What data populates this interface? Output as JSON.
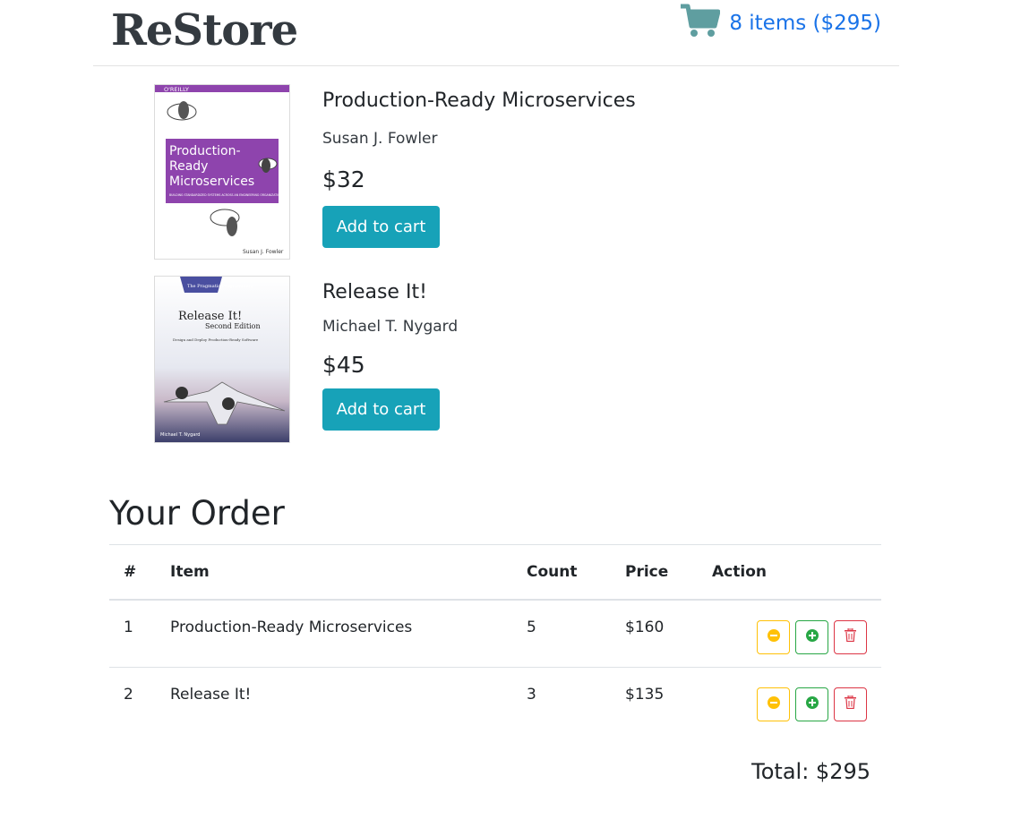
{
  "header": {
    "brand": "ReStore",
    "cart_label": "8 items ($295)"
  },
  "products": [
    {
      "title": "Production-Ready Microservices",
      "author": "Susan J. Fowler",
      "price": "$32",
      "button": "Add to cart",
      "cover": {
        "publisher": "O'REILLY",
        "line1": "Production-",
        "line2": "Ready",
        "line3": "Microservices",
        "subtitle": "BUILDING STANDARDIZED SYSTEMS ACROSS AN ENGINEERING ORGANIZATION",
        "author": "Susan J. Fowler"
      }
    },
    {
      "title": "Release It!",
      "author": "Michael T. Nygard",
      "price": "$45",
      "button": "Add to cart",
      "cover": {
        "publisher": "The Pragmatic Programmers",
        "line1": "Release It!",
        "line2": "Second Edition",
        "line3": "Design and Deploy Production-Ready Software",
        "author": "Michael T. Nygard"
      }
    }
  ],
  "order": {
    "title": "Your Order",
    "columns": [
      "#",
      "Item",
      "Count",
      "Price",
      "Action"
    ],
    "rows": [
      {
        "num": "1",
        "item": "Production-Ready Microservices",
        "count": "5",
        "price": "$160"
      },
      {
        "num": "2",
        "item": "Release It!",
        "count": "3",
        "price": "$135"
      }
    ],
    "total": "Total: $295"
  },
  "colors": {
    "accent": "#17a2b8",
    "link": "#1a73e8",
    "cart_icon": "#5f9ea0",
    "decrement": "#ffc107",
    "increment": "#28a745",
    "delete": "#dc3545"
  },
  "icons": {
    "cart": "cart-icon",
    "decrement": "minus-circle-icon",
    "increment": "plus-circle-icon",
    "delete": "trash-icon"
  }
}
